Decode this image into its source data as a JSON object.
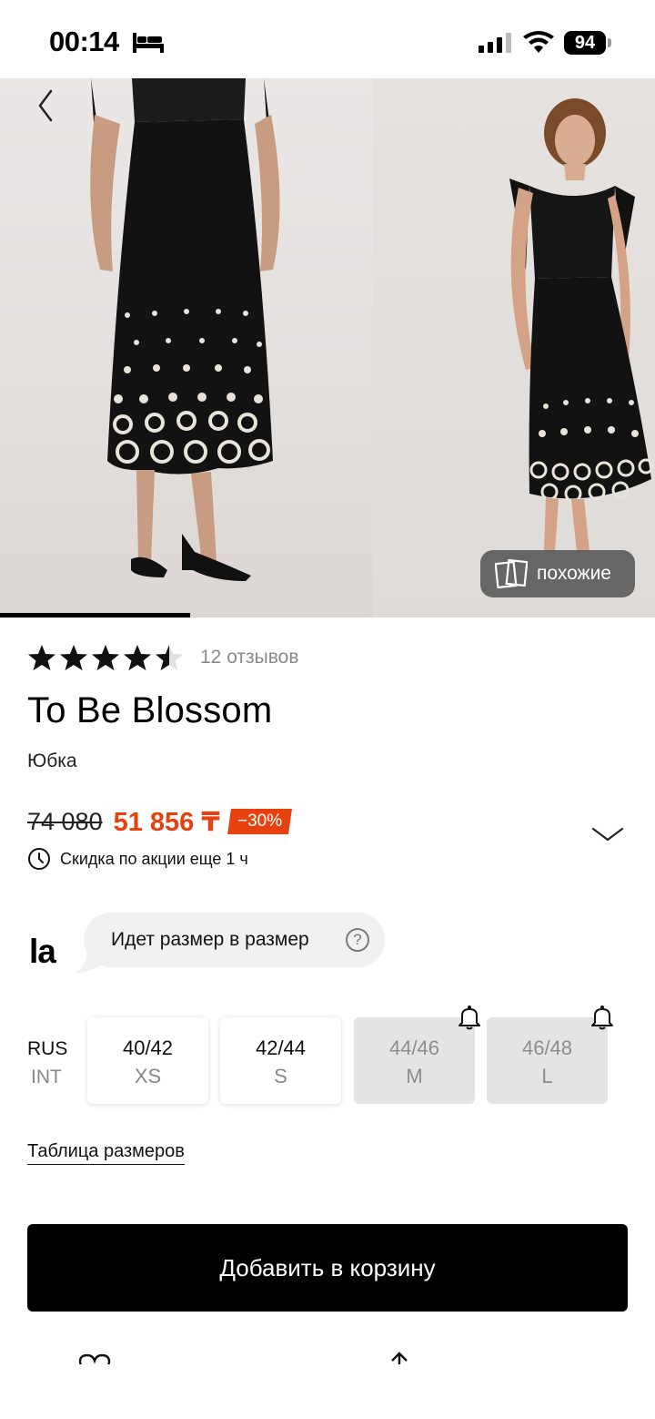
{
  "status_bar": {
    "time": "00:14",
    "battery": "94",
    "icons": [
      "bed-icon",
      "signal-icon",
      "wifi-icon",
      "battery-icon"
    ]
  },
  "gallery": {
    "photo_count_visible": 2,
    "similar_label": "похожие",
    "progress_fraction": 0.29
  },
  "product": {
    "rating": 4.5,
    "rating_max": 5,
    "reviews_label": "12 отзывов",
    "brand": "To Be Blossom",
    "category": "Юбка",
    "old_price": "74 080",
    "new_price": "51 856 ₸",
    "discount": "−30%",
    "promo_text": "Скидка по акции еще 1 ч"
  },
  "fit": {
    "logo_text": "la",
    "message": "Идет размер в размер",
    "help_symbol": "?"
  },
  "sizes": {
    "label_rus": "RUS",
    "label_int": "INT",
    "items": [
      {
        "rus": "40/42",
        "int": "XS",
        "available": true
      },
      {
        "rus": "42/44",
        "int": "S",
        "available": true
      },
      {
        "rus": "44/46",
        "int": "M",
        "available": false
      },
      {
        "rus": "46/48",
        "int": "L",
        "available": false
      }
    ],
    "size_table_link": "Таблица размеров"
  },
  "actions": {
    "add_to_cart": "Добавить в корзину"
  },
  "colors": {
    "accent": "#e6410f",
    "button": "#000000",
    "unavailable": "#e4e4e4"
  }
}
